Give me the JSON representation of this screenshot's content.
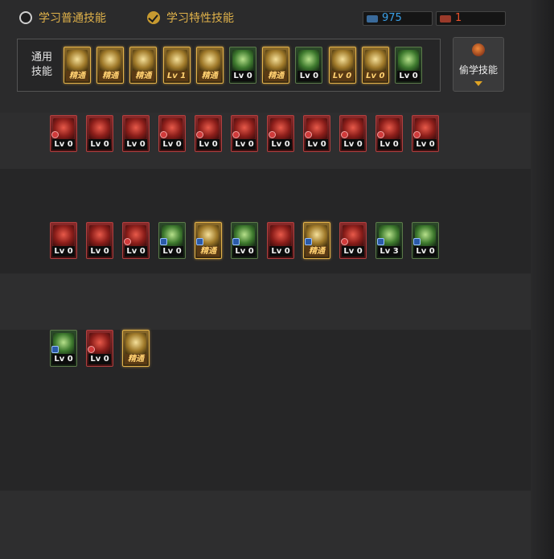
{
  "tabs": {
    "normal_label": "学习普通技能",
    "special_label": "学习特性技能"
  },
  "points": {
    "sp_value": "975",
    "tp_value": "1",
    "sp_color": "#3aa0e8",
    "tp_color": "#e8502a"
  },
  "common": {
    "label": "通用\n技能"
  },
  "steal_button": {
    "label": "偷学技能"
  },
  "common_skills": [
    {
      "level": "精通",
      "tier": "gold"
    },
    {
      "level": "精通",
      "tier": "gold"
    },
    {
      "level": "精通",
      "tier": "gold"
    },
    {
      "level": "Lv 1",
      "tier": "gold"
    },
    {
      "level": "精通",
      "tier": "gold"
    },
    {
      "level": "Lv 0",
      "tier": "green"
    },
    {
      "level": "精通",
      "tier": "gold"
    },
    {
      "level": "Lv 0",
      "tier": "green"
    },
    {
      "level": "Lv 0",
      "tier": "gold"
    },
    {
      "level": "Lv 0",
      "tier": "gold"
    },
    {
      "level": "Lv 0",
      "tier": "green"
    }
  ],
  "rows": [
    {
      "skills": [
        {
          "level": "Lv 0",
          "tier": "red",
          "mark": "seal"
        },
        {
          "level": "Lv 0",
          "tier": "red",
          "mark": ""
        },
        {
          "level": "Lv 0",
          "tier": "red",
          "mark": ""
        },
        {
          "level": "Lv 0",
          "tier": "red",
          "mark": "seal"
        },
        {
          "level": "Lv 0",
          "tier": "red",
          "mark": "seal"
        },
        {
          "level": "Lv 0",
          "tier": "red",
          "mark": "seal"
        },
        {
          "level": "Lv 0",
          "tier": "red",
          "mark": "seal"
        },
        {
          "level": "Lv 0",
          "tier": "red",
          "mark": "seal"
        },
        {
          "level": "Lv 0",
          "tier": "red",
          "mark": "seal"
        },
        {
          "level": "Lv 0",
          "tier": "red",
          "mark": "seal"
        },
        {
          "level": "Lv 0",
          "tier": "red",
          "mark": "seal"
        }
      ]
    },
    {
      "skills": [
        {
          "level": "Lv 0",
          "tier": "red",
          "mark": ""
        },
        {
          "level": "Lv 0",
          "tier": "red",
          "mark": ""
        },
        {
          "level": "Lv 0",
          "tier": "red",
          "mark": "seal"
        },
        {
          "level": "Lv 0",
          "tier": "green",
          "mark": "ex"
        },
        {
          "level": "精通",
          "tier": "gold",
          "mark": "ex"
        },
        {
          "level": "Lv 0",
          "tier": "green",
          "mark": "ex"
        },
        {
          "level": "Lv 0",
          "tier": "red",
          "mark": ""
        },
        {
          "level": "精通",
          "tier": "gold",
          "mark": "ex"
        },
        {
          "level": "Lv 0",
          "tier": "red",
          "mark": "seal"
        },
        {
          "level": "Lv 3",
          "tier": "green",
          "mark": "ex"
        },
        {
          "level": "Lv 0",
          "tier": "green",
          "mark": "ex"
        }
      ]
    },
    {
      "skills": [
        {
          "level": "Lv 0",
          "tier": "green",
          "mark": "ex"
        },
        {
          "level": "Lv 0",
          "tier": "red",
          "mark": "seal"
        },
        {
          "level": "精通",
          "tier": "gold",
          "mark": ""
        }
      ]
    }
  ]
}
